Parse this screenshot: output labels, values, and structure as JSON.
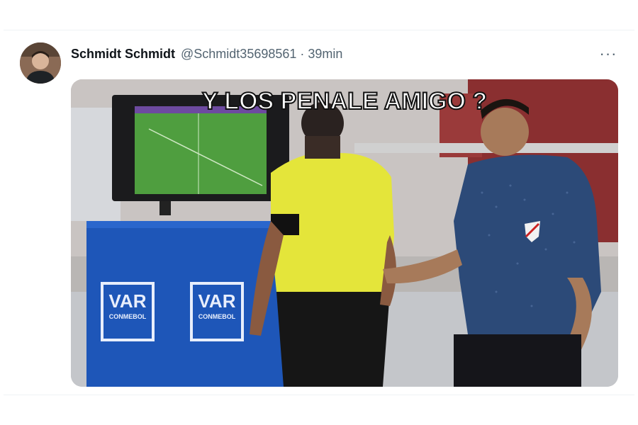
{
  "tweet": {
    "display_name": "Schmidt Schmidt",
    "handle": "@Schmidt35698561",
    "separator": "·",
    "time": "39min",
    "more_label": "···"
  },
  "media": {
    "meme_caption": "Y LOS PENALE AMIGO ?",
    "var_logo_1": "VAR",
    "var_sub_1": "CONMEBOL",
    "var_logo_2": "VAR",
    "var_sub_2": "CONMEBOL"
  }
}
